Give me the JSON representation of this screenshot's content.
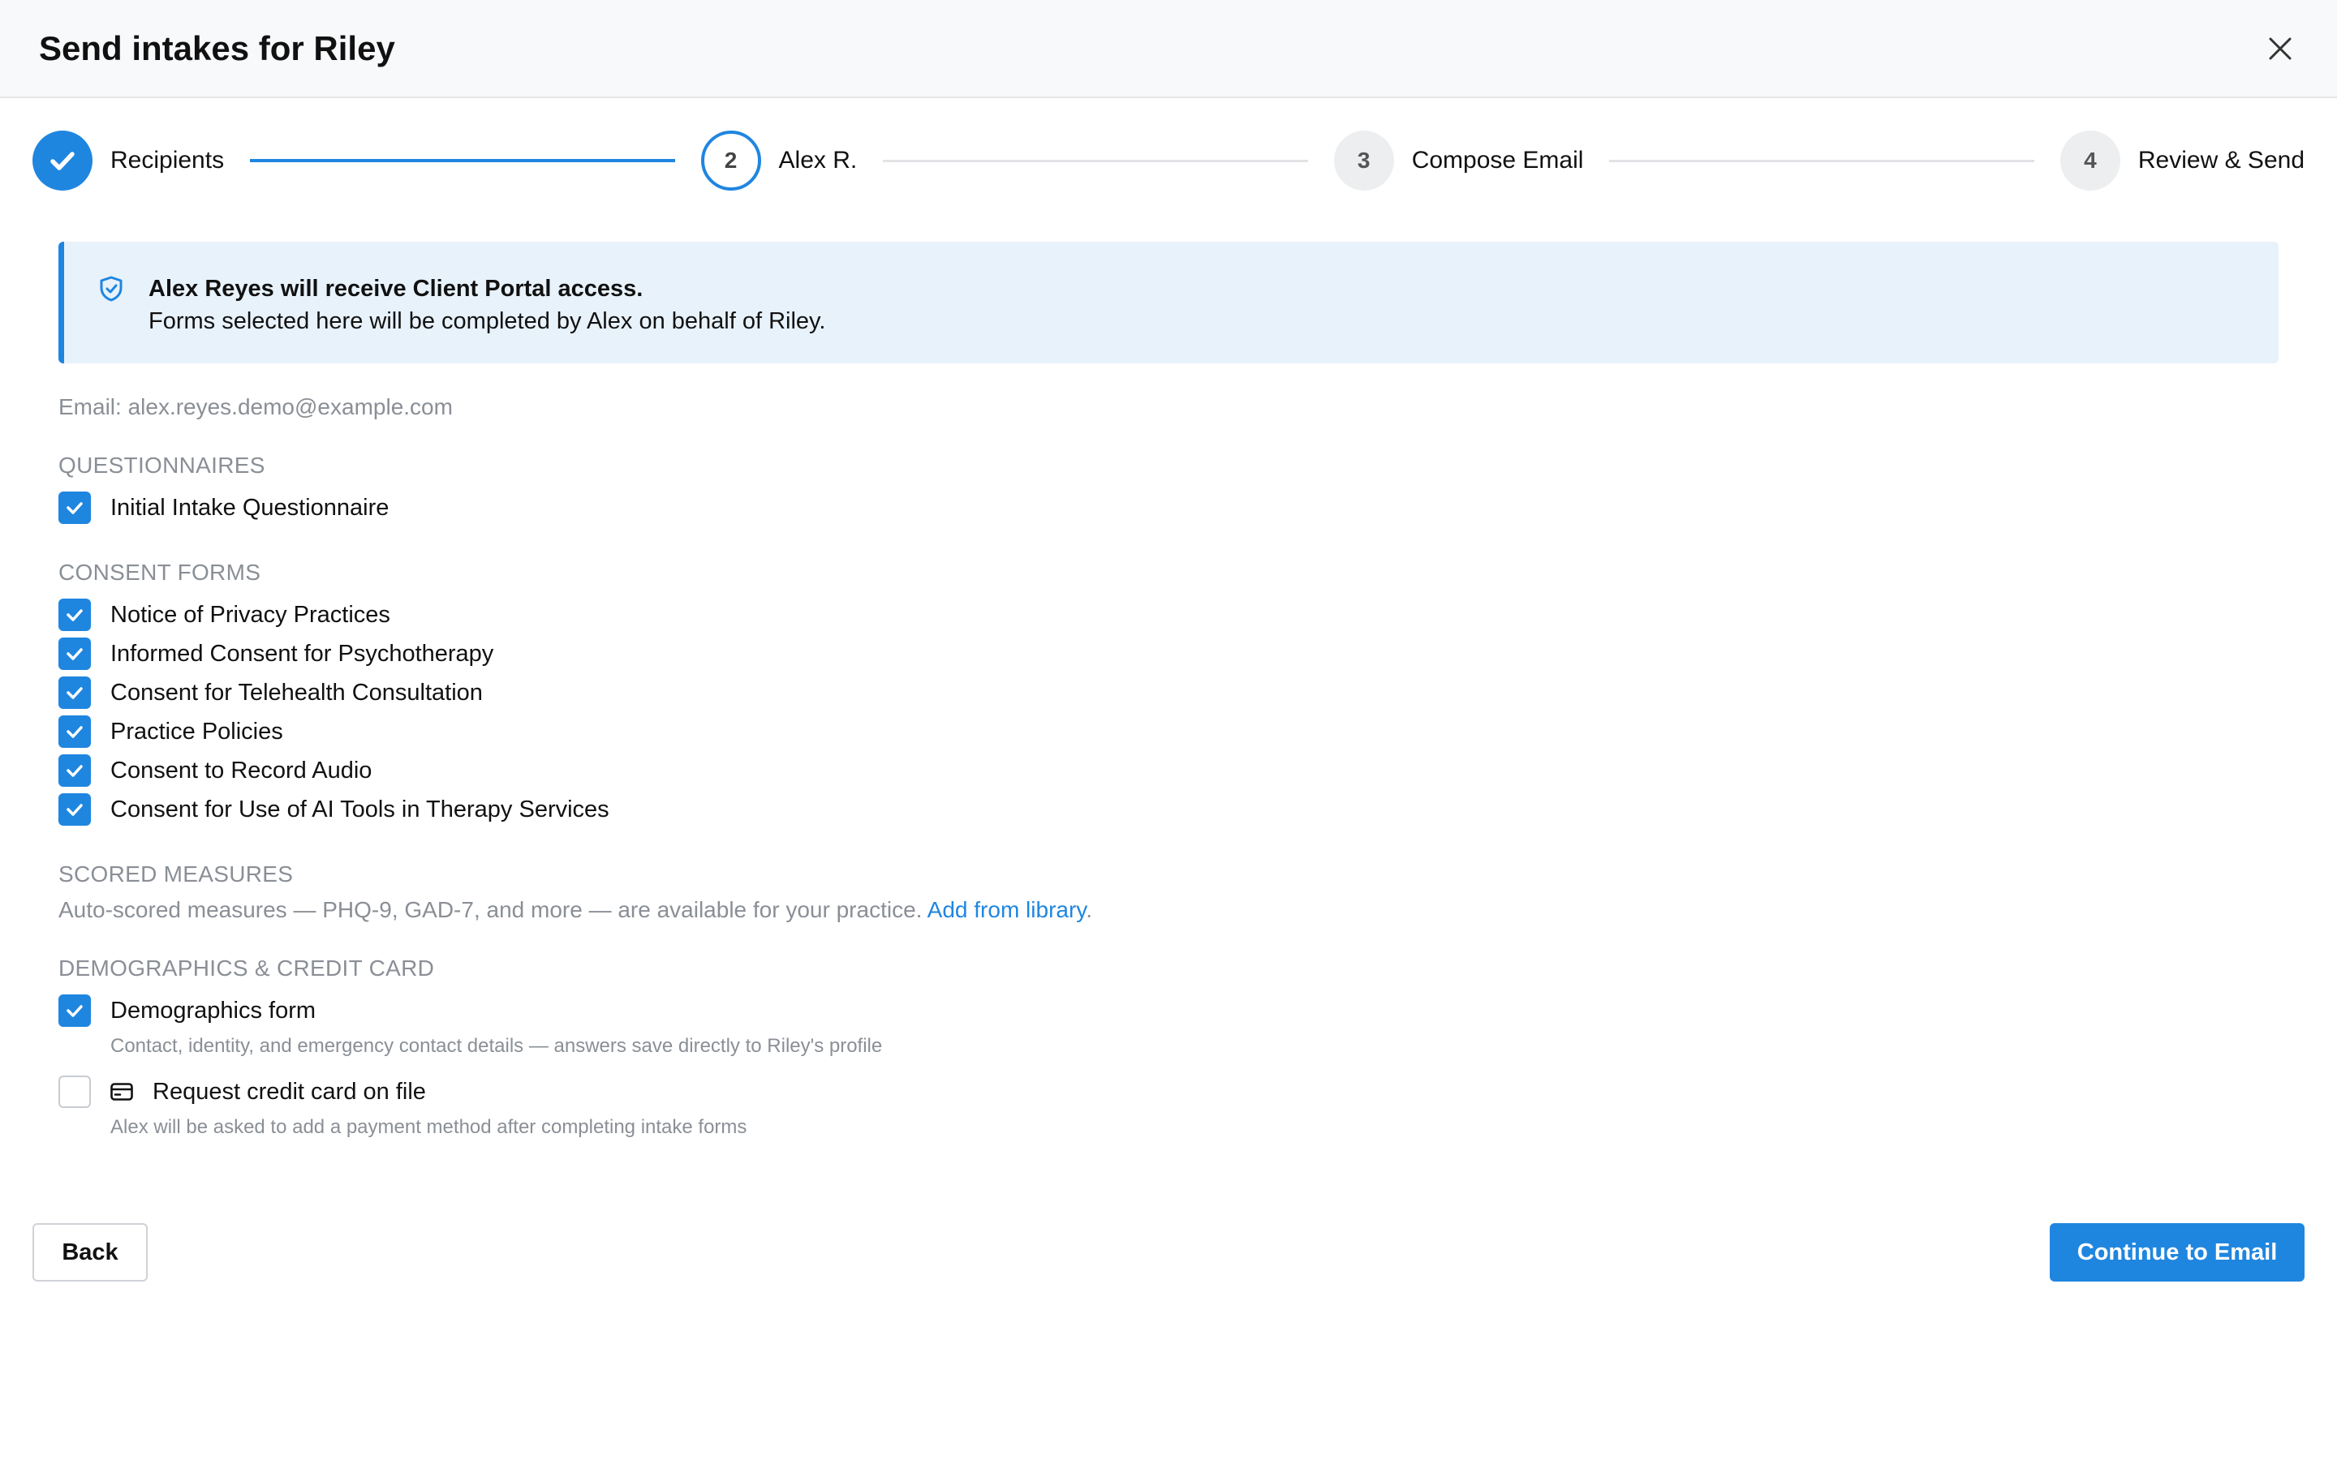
{
  "dialog": {
    "title": "Send intakes for Riley",
    "close_icon": "close-icon"
  },
  "stepper": {
    "steps": [
      {
        "number": "1",
        "label": "Recipients",
        "state": "completed"
      },
      {
        "number": "2",
        "label": "Alex R.",
        "state": "current"
      },
      {
        "number": "3",
        "label": "Compose Email",
        "state": "upcoming"
      },
      {
        "number": "4",
        "label": "Review & Send",
        "state": "upcoming"
      }
    ]
  },
  "banner": {
    "icon": "shield-icon",
    "title": "Alex Reyes will receive Client Portal access.",
    "text": "Forms selected here will be completed by Alex on behalf of Riley."
  },
  "email_line": "Email: alex.reyes.demo@example.com",
  "sections": {
    "questionnaires": {
      "title": "QUESTIONNAIRES",
      "items": [
        {
          "label": "Initial Intake Questionnaire",
          "checked": true
        }
      ]
    },
    "consent_forms": {
      "title": "CONSENT FORMS",
      "items": [
        {
          "label": "Notice of Privacy Practices",
          "checked": true
        },
        {
          "label": "Informed Consent for Psychotherapy",
          "checked": true
        },
        {
          "label": "Consent for Telehealth Consultation",
          "checked": true
        },
        {
          "label": "Practice Policies",
          "checked": true
        },
        {
          "label": "Consent to Record Audio",
          "checked": true
        },
        {
          "label": "Consent for Use of AI Tools in Therapy Services",
          "checked": true
        }
      ]
    },
    "scored_measures": {
      "title": "SCORED MEASURES",
      "text": "Auto-scored measures — PHQ-9, GAD-7, and more — are available for your practice. ",
      "link": "Add from library",
      "suffix": "."
    },
    "demographics": {
      "title": "DEMOGRAPHICS & CREDIT CARD",
      "demographics_form": {
        "label": "Demographics form",
        "checked": true,
        "description": "Contact, identity, and emergency contact details — answers save directly to Riley's profile"
      },
      "credit_card": {
        "label": "Request credit card on file",
        "checked": false,
        "icon": "credit-card-icon",
        "description": "Alex will be asked to add a payment method after completing intake forms"
      }
    }
  },
  "footer": {
    "back_label": "Back",
    "continue_label": "Continue to Email"
  },
  "colors": {
    "accent": "#1f86e0",
    "banner_bg": "#e8f2fb",
    "muted_text": "#8a8f96"
  }
}
